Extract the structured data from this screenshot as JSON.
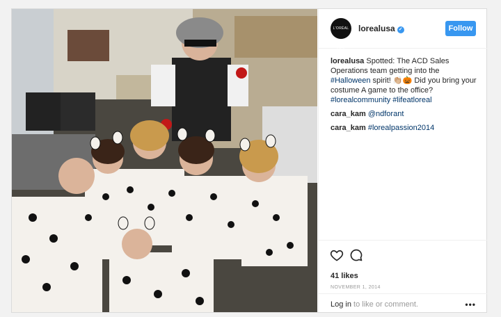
{
  "post": {
    "username": "lorealusa",
    "avatar_text": "L'ORÉAL USA",
    "follow_label": "Follow",
    "caption_user": "lorealusa",
    "caption_text_1": "Spotted: The ACD Sales Operations team getting into the ",
    "caption_tag_1": "#Halloween",
    "caption_text_2": " spirit! 👏🏼🎃 Did you bring your costume A game to the office? ",
    "caption_tag_2": "#lorealcommunity",
    "caption_tag_3": "#lifeatloreal",
    "comments": [
      {
        "user": "cara_kam",
        "text": "@ndforant"
      },
      {
        "user": "cara_kam",
        "text": "#lorealpassion2014"
      }
    ],
    "likes": "41 likes",
    "date": "NOVEMBER 1, 2014",
    "login_link": "Log in",
    "login_rest": " to like or comment.",
    "more_label": "•••"
  },
  "icons": [
    "heart-icon",
    "comment-icon",
    "verified-icon",
    "more-icon"
  ],
  "colors": {
    "accent": "#3897f0",
    "link": "#003569"
  }
}
